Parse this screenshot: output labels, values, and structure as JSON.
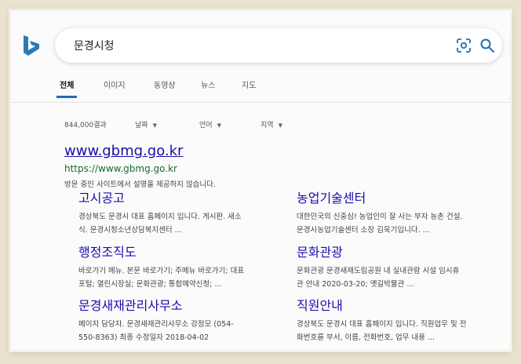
{
  "search": {
    "query": "문경시청"
  },
  "tabs": [
    "전체",
    "이미지",
    "동영상",
    "뉴스",
    "지도"
  ],
  "filters": {
    "result_count": "844,000결과",
    "date": "날짜",
    "language": "언어",
    "region": "지역"
  },
  "result": {
    "title": "www.gbmg.go.kr",
    "url": "https://www.gbmg.go.kr",
    "description": "방문 중인 사이트에서 설명을 제공하지 않습니다."
  },
  "sublinks": [
    {
      "title": "고시공고",
      "line1": "경상북도 문경시 대표 홈페이지 입니다. 게시판. 새소",
      "line2": "식. 문경시청소년상담복지센터 ..."
    },
    {
      "title": "농업기술센터",
      "line1": "대한민국의 신중심! 농업인이 잘 사는 부자 농촌 건설.",
      "line2": "문경시농업기술센터 소장 김욱기입니다. ..."
    },
    {
      "title": "행정조직도",
      "line1": "바로가기 메뉴. 본문 바로가기; 주메뉴 바로가기; 대표",
      "line2": "포털; 열린시장실; 문화관광; 통합예약신청; ..."
    },
    {
      "title": "문화관광",
      "line1": "문화관광 문경새재도립공원 내 실내관람 시설 임시휴",
      "line2": "관 안내 2020-03-20; 옛길박물관 ..."
    },
    {
      "title": "문경새재관리사무소",
      "line1": "페이지 담당자. 문경새재관리사무소 강정모 (054-",
      "line2": "550-8363) 최종 수정일자 2018-04-02"
    },
    {
      "title": "직원안내",
      "line1": "경상북도 문경시 대표 홈페이지 입니다. 직원업무 및 전",
      "line2": "화번호를 부서, 이름, 전화번호, 업무 내용 ..."
    }
  ],
  "icons": {
    "logo": "bing-logo-icon",
    "visual_search": "visual-search-icon",
    "search": "search-icon",
    "dropdown": "chevron-down-icon"
  },
  "colors": {
    "accent": "#1e6fb8",
    "link": "#1a0dab",
    "url_green": "#1c6b2c",
    "logo": "#2a7ab8"
  }
}
